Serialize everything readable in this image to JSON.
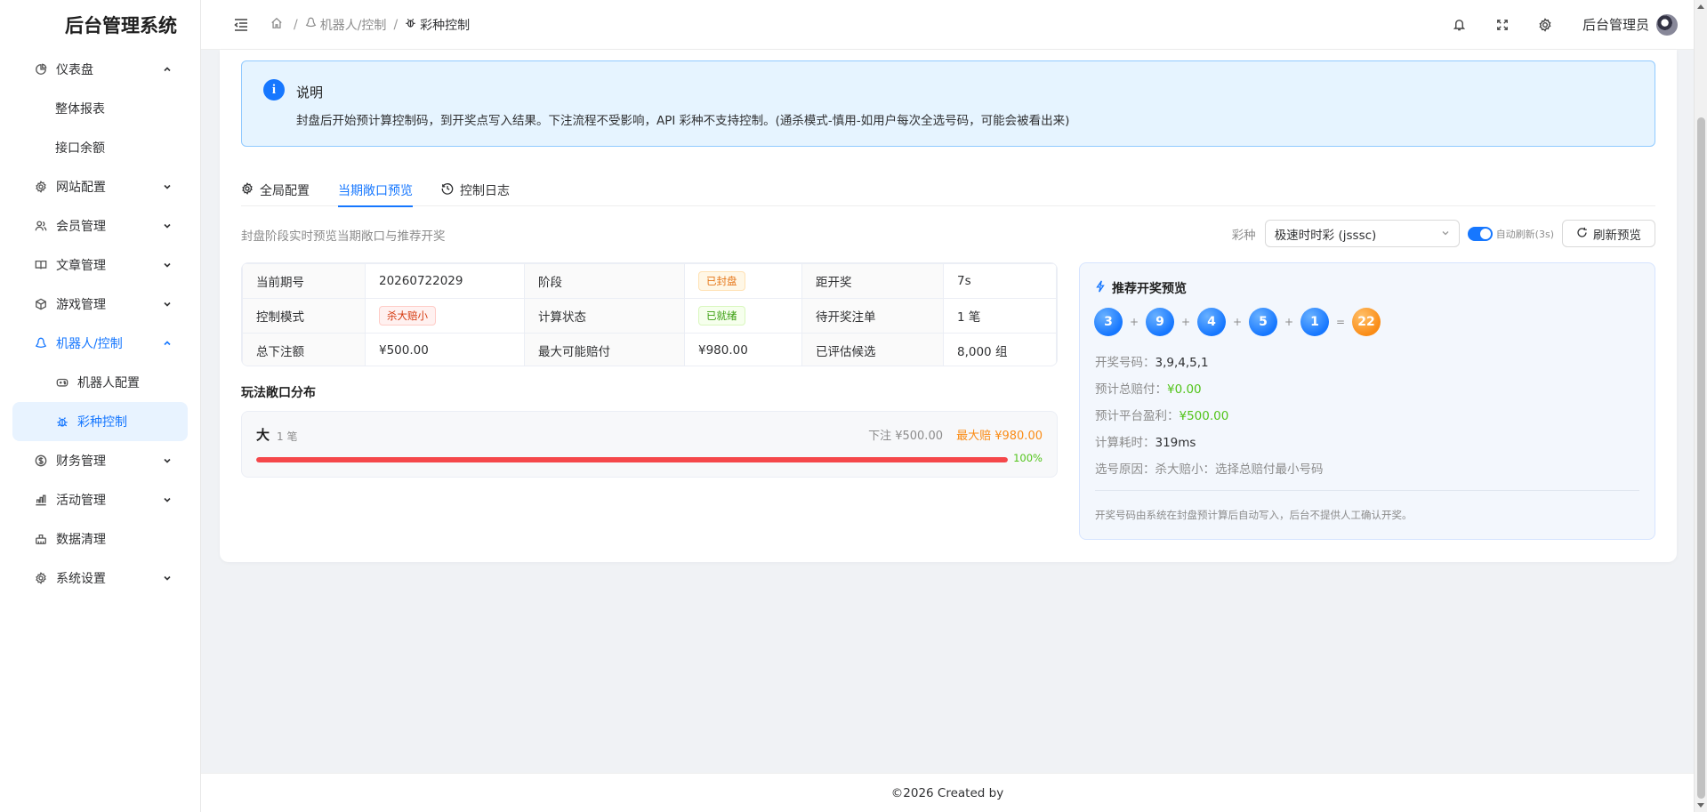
{
  "app": {
    "title": "后台管理系统"
  },
  "sidebar": {
    "items": [
      {
        "label": "仪表盘",
        "icon": "pie-chart-icon",
        "expanded": true,
        "children": [
          {
            "label": "整体报表"
          },
          {
            "label": "接口余额"
          }
        ]
      },
      {
        "label": "网站配置",
        "icon": "gear-icon"
      },
      {
        "label": "会员管理",
        "icon": "users-icon"
      },
      {
        "label": "文章管理",
        "icon": "book-icon"
      },
      {
        "label": "游戏管理",
        "icon": "cube-icon"
      },
      {
        "label": "机器人/控制",
        "icon": "robot-icon",
        "expanded": true,
        "children": [
          {
            "label": "机器人配置",
            "icon": "gamepad-icon"
          },
          {
            "label": "彩种控制",
            "icon": "bug-icon",
            "active": true
          }
        ]
      },
      {
        "label": "财务管理",
        "icon": "dollar-icon"
      },
      {
        "label": "活动管理",
        "icon": "chart-icon"
      },
      {
        "label": "数据清理",
        "icon": "broom-icon"
      },
      {
        "label": "系统设置",
        "icon": "gear-icon"
      }
    ]
  },
  "header": {
    "breadcrumb": [
      {
        "label": "机器人/控制"
      },
      {
        "label": "彩种控制"
      }
    ],
    "user": "后台管理员"
  },
  "alert": {
    "title": "说明",
    "desc": "封盘后开始预计算控制码，到开奖点写入结果。下注流程不受影响，API 彩种不支持控制。(通杀模式-慎用-如用户每次全选号码，可能会被看出来)"
  },
  "tabs": [
    {
      "label": "全局配置"
    },
    {
      "label": "当期敞口预览",
      "active": true
    },
    {
      "label": "控制日志"
    }
  ],
  "preview": {
    "subdesc": "封盘阶段实时预览当期敞口与推荐开奖",
    "lottery_label": "彩种",
    "lottery_value": "极速时时彩 (jsssc)",
    "auto_refresh_label": "自动刷新(3s)",
    "auto_refresh_on": true,
    "refresh_button": "刷新预览"
  },
  "info": {
    "r1": {
      "l1": "当前期号",
      "v1": "20260722029",
      "l2": "阶段",
      "v2": "已封盘",
      "l3": "距开奖",
      "v3": "7s"
    },
    "r2": {
      "l1": "控制模式",
      "v1": "杀大赔小",
      "l2": "计算状态",
      "v2": "已就绪",
      "l3": "待开奖注单",
      "v3": "1 笔"
    },
    "r3": {
      "l1": "总下注额",
      "v1": "¥500.00",
      "l2": "最大可能赔付",
      "v2": "¥980.00",
      "l3": "已评估候选",
      "v3": "8,000 组"
    }
  },
  "distribution": {
    "title": "玩法敞口分布",
    "items": [
      {
        "name": "大",
        "count": "1 笔",
        "bet": "下注 ¥500.00",
        "max": "最大赔 ¥980.00",
        "percent": 100,
        "percent_label": "100%"
      }
    ]
  },
  "recommend": {
    "title": "推荐开奖预览",
    "balls": [
      "3",
      "9",
      "4",
      "5",
      "1"
    ],
    "plus": "+",
    "equals": "=",
    "sum": "22",
    "draw_label": "开奖号码：",
    "draw_value": "3,9,4,5,1",
    "payout_label": "预计总赔付：",
    "payout_value": "¥0.00",
    "profit_label": "预计平台盈利：",
    "profit_value": "¥500.00",
    "time_label": "计算耗时：",
    "time_value": "319ms",
    "reason_label": "选号原因：",
    "reason_value": "杀大赔小：选择总赔付最小号码",
    "note": "开奖号码由系统在封盘预计算后自动写入，后台不提供人工确认开奖。"
  },
  "footer": {
    "text": "©2026 Created by"
  },
  "colors": {
    "primary": "#1677ff",
    "danger": "#f5474a",
    "warning": "#fa8c16",
    "success": "#52c41a"
  }
}
